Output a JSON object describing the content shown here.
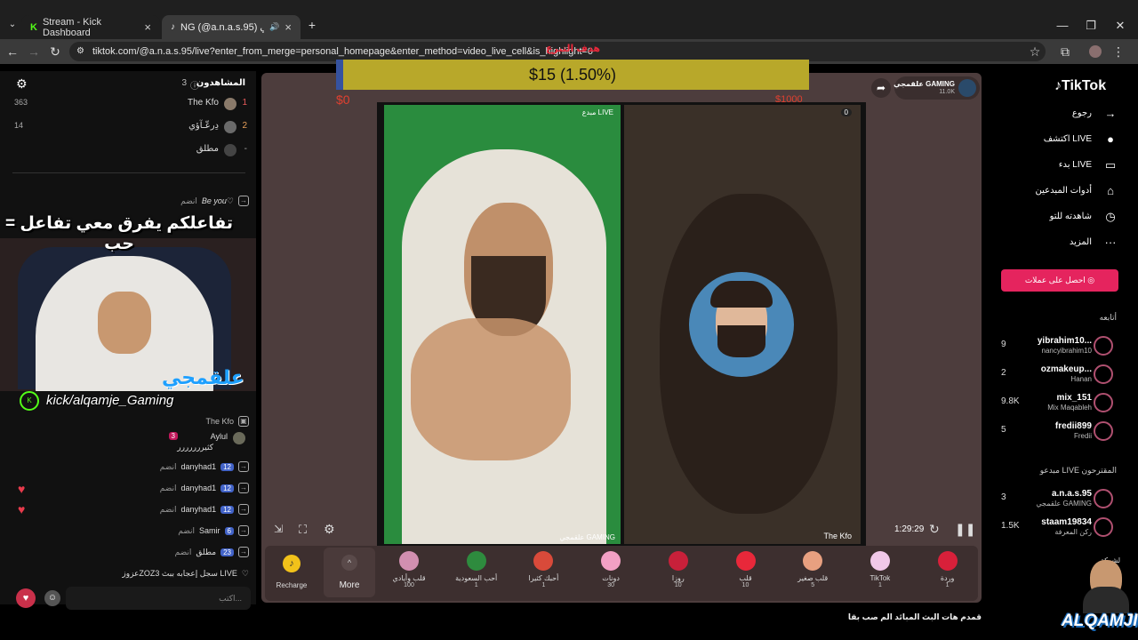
{
  "browser": {
    "tabs": [
      {
        "label": "Stream - Kick Dashboard"
      },
      {
        "label": "NG (@a.n.a.s.95) علقمجي"
      }
    ],
    "url": "tiktok.com/@a.n.a.s.95/live?enter_from_merge=personal_homepage&enter_method=video_live_cell&is_highlight=0"
  },
  "donation": {
    "goal_label": "هدف التبرع",
    "progress_text": "$15 (1.50%)",
    "min": "$0",
    "max": "$1000",
    "progress_fraction": 0.015
  },
  "overlay": {
    "banner": "تفاعلكم يفرق معي تفاعل = حب",
    "streamer_name": "علقمجي",
    "kick_handle": "kick/alqamje_Gaming",
    "brand": "ALQAMJI",
    "corner_text": "لشركة"
  },
  "viewers": {
    "title": "المشاهدون",
    "count": "3",
    "rows": [
      {
        "rank": "1",
        "name": "The Kfo",
        "score": "363"
      },
      {
        "rank": "2",
        "name": "دِرعّـآؤي",
        "score": "14"
      },
      {
        "rank": "-",
        "name": "مطلق",
        "score": ""
      }
    ]
  },
  "chat": {
    "rows": [
      {
        "name": "Be you♡",
        "text": "انضم",
        "badge": ""
      },
      {
        "name": "danyhad1",
        "text": "",
        "badge": "12"
      },
      {
        "name": "The Kfo",
        "text": "",
        "badge": ""
      },
      {
        "name": "Aylul",
        "text": "كثيررررررر",
        "badge": "3"
      },
      {
        "name": "danyhad1",
        "text": "انضم",
        "badge": "12"
      },
      {
        "name": "danyhad1",
        "text": "انضم",
        "badge": "12"
      },
      {
        "name": "danyhad1",
        "text": "انضم",
        "badge": "12"
      },
      {
        "name": "Samir",
        "text": "انضم",
        "badge": "6"
      },
      {
        "name": "مطلق",
        "text": "انضم",
        "badge": "23"
      },
      {
        "name": "",
        "text": "عزوزZOZ3 سجل إعجابه ببث LIVE",
        "badge": ""
      }
    ],
    "input_placeholder": "اكتب..."
  },
  "stream": {
    "host_label": "مبدع LIVE",
    "host_name": "علقمجي GAMING",
    "guest_name": "The Kfo",
    "guest_score": "0",
    "timer": "1:29:29",
    "header_name": "علقمجي GAMING",
    "header_likes": "11.0K"
  },
  "gifts": {
    "recharge_label": "Recharge",
    "more_label": "More",
    "items": [
      {
        "name": "قلب وأيادي",
        "price": "100",
        "color": "#d28fb0"
      },
      {
        "name": "أحب السعودية",
        "price": "1",
        "color": "#2e8b3e"
      },
      {
        "name": "أحبك كثيرا",
        "price": "1",
        "color": "#d94a3a"
      },
      {
        "name": "دونات",
        "price": "30",
        "color": "#f2a0c4"
      },
      {
        "name": "روزا",
        "price": "10",
        "color": "#c8203a"
      },
      {
        "name": "قلب",
        "price": "10",
        "color": "#e8283a"
      },
      {
        "name": "قلب صغير",
        "price": "5",
        "color": "#e8a080"
      },
      {
        "name": "TikTok",
        "price": "1",
        "color": "#f0c8e8"
      },
      {
        "name": "وردة",
        "price": "1",
        "color": "#d8203a"
      }
    ]
  },
  "bottom_caption": "قمدم هات البث المبائد  الم صب بقا",
  "tiktok": {
    "logo": "TikTok",
    "nav": [
      {
        "label": "رجوع",
        "icon": "arrow-icon"
      },
      {
        "label": "اكتشف LIVE",
        "icon": "avatar-icon"
      },
      {
        "label": "بدء LIVE",
        "icon": "camera-icon"
      },
      {
        "label": "أدوات المبدعين",
        "icon": "home-icon"
      },
      {
        "label": "شاهدته للتو",
        "icon": "history-icon"
      },
      {
        "label": "المزيد",
        "icon": "more-icon"
      }
    ],
    "coins_button": "احصل على عملات",
    "following_title": "أتابعه",
    "following": [
      {
        "count": "9",
        "name": "yibrahim10...",
        "sub": "nancyibrahim10"
      },
      {
        "count": "2",
        "name": "ozmakeup...",
        "sub": "Hanan"
      },
      {
        "count": "9.8K",
        "name": "mix_151",
        "sub": "Mix Maqableh"
      },
      {
        "count": "5",
        "name": "fredii899",
        "sub": "Fredii"
      }
    ],
    "suggested_title": "مبدعو LIVE المقترحون",
    "suggested": [
      {
        "count": "3",
        "name": "a.n.a.s.95",
        "sub": "علقمجي GAMING"
      },
      {
        "count": "1.5K",
        "name": "staam19834",
        "sub": "ركن المعرفة"
      }
    ]
  }
}
